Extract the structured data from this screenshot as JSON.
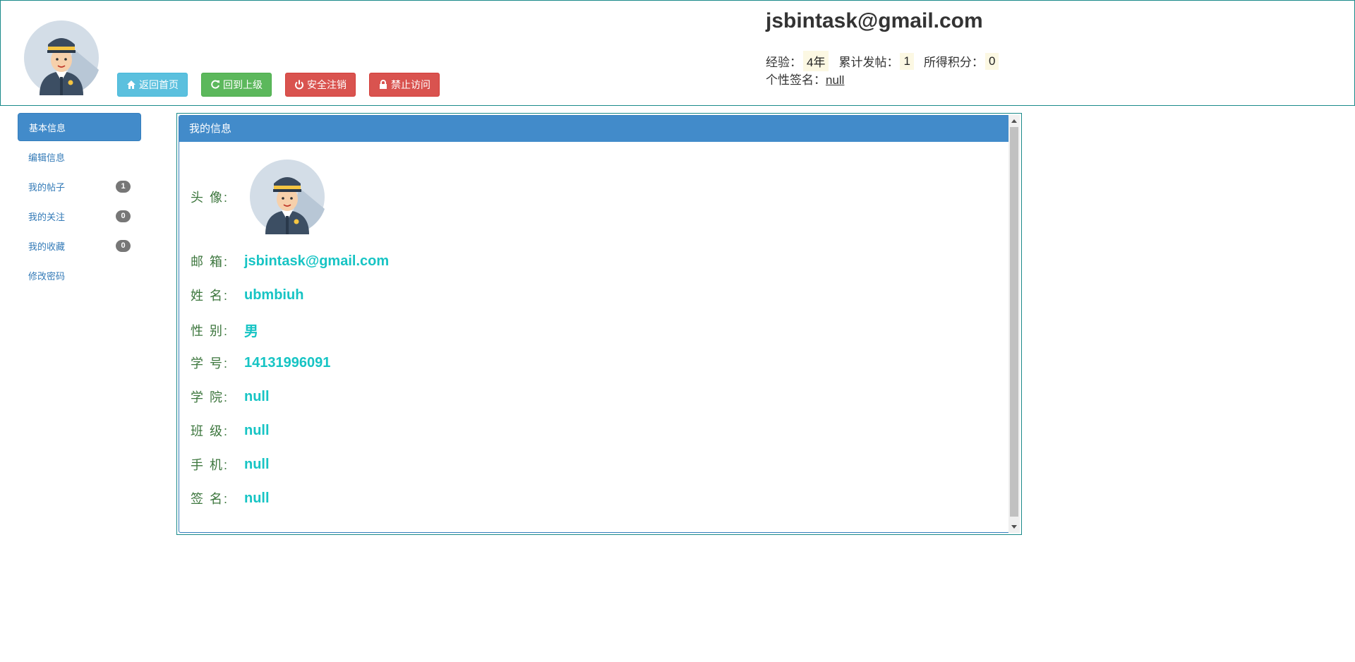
{
  "header": {
    "email": "jsbintask@gmail.com",
    "buttons": {
      "home": "返回首页",
      "back": "回到上级",
      "logout": "安全注销",
      "block": "禁止访问"
    },
    "stats": {
      "experience_label": "经验：",
      "experience_value": "4年",
      "posts_label": "累计发帖：",
      "posts_value": "1",
      "points_label": "所得积分：",
      "points_value": "0"
    },
    "signature_label": "个性签名：",
    "signature_value": "null"
  },
  "sidebar": {
    "items": [
      {
        "label": "基本信息",
        "badge": null,
        "active": true
      },
      {
        "label": "编辑信息",
        "badge": null
      },
      {
        "label": "我的帖子",
        "badge": "1"
      },
      {
        "label": "我的关注",
        "badge": "0"
      },
      {
        "label": "我的收藏",
        "badge": "0"
      },
      {
        "label": "修改密码",
        "badge": null
      }
    ]
  },
  "panel": {
    "title": "我的信息",
    "avatar_label": "头 像:",
    "fields": [
      {
        "label": "邮 箱:",
        "value": "jsbintask@gmail.com"
      },
      {
        "label": "姓 名:",
        "value": "ubmbiuh"
      },
      {
        "label": "性 别:",
        "value": "男"
      },
      {
        "label": "学 号:",
        "value": "14131996091"
      },
      {
        "label": "学 院:",
        "value": "null"
      },
      {
        "label": "班 级:",
        "value": "null"
      },
      {
        "label": "手 机:",
        "value": "null"
      },
      {
        "label": "签 名:",
        "value": "null"
      }
    ]
  },
  "colors": {
    "accent": "#428bca",
    "value_text": "#17c4c4",
    "label_text": "#3c763d",
    "border": "#1a8a8a"
  }
}
